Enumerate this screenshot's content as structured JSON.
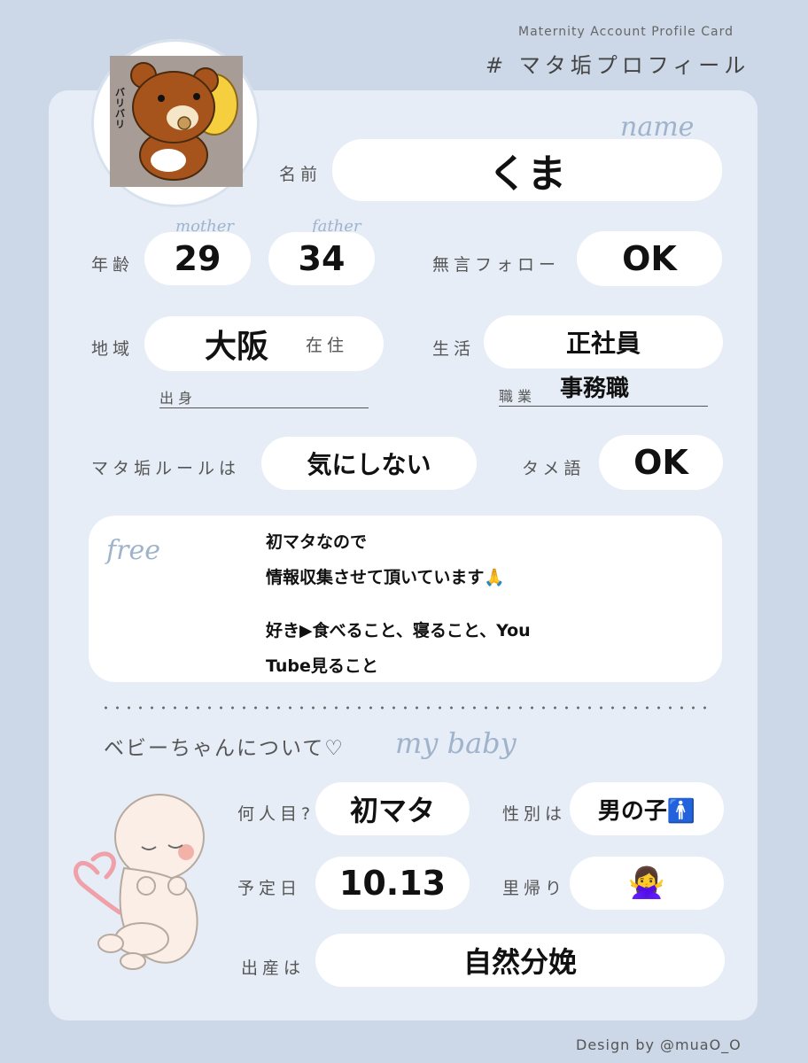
{
  "header": {
    "subtitle": "Maternity Account Profile Card",
    "title": "# マタ垢プロフィール"
  },
  "avatar": {
    "icon": "bear-eating-icon",
    "sfx": "バリバリ"
  },
  "name": {
    "script": "name",
    "label": "名前",
    "value": "くま"
  },
  "age": {
    "label": "年齢",
    "mother_script": "mother",
    "mother": "29",
    "father_script": "father",
    "father": "34"
  },
  "silent_follow": {
    "label": "無言フォロー",
    "value": "OK"
  },
  "region": {
    "label": "地域",
    "value": "大阪",
    "suffix": "在住",
    "origin_label": "出身"
  },
  "life": {
    "label": "生活",
    "value": "正社員",
    "job_label": "職業",
    "job": "事務職"
  },
  "rules": {
    "label": "マタ垢ルールは",
    "value": "気にしない"
  },
  "casual": {
    "label": "タメ語",
    "value": "OK"
  },
  "free": {
    "script": "free",
    "lines": [
      "初マタなので",
      "情報収集させて頂いています🙏",
      "好き▶︎食べること、寝ること、You",
      "Tube見ること"
    ]
  },
  "baby": {
    "heading": "ベビーちゃんについて♡",
    "script": "my baby",
    "which_label": "何人目?",
    "which": "初マタ",
    "gender_label": "性別は",
    "gender": "男の子🚹",
    "due_label": "予定日",
    "due": "10.13",
    "homecoming_label": "里帰り",
    "homecoming": "🙅‍♀️",
    "birth_label": "出産は",
    "birth": "自然分娩"
  },
  "footer": "Design by @muaO_O",
  "colors": {
    "background": "#ccd8e8",
    "card": "#e6edf6",
    "accent_script": "#9fb3cc",
    "heart": "#f0a0a8"
  }
}
